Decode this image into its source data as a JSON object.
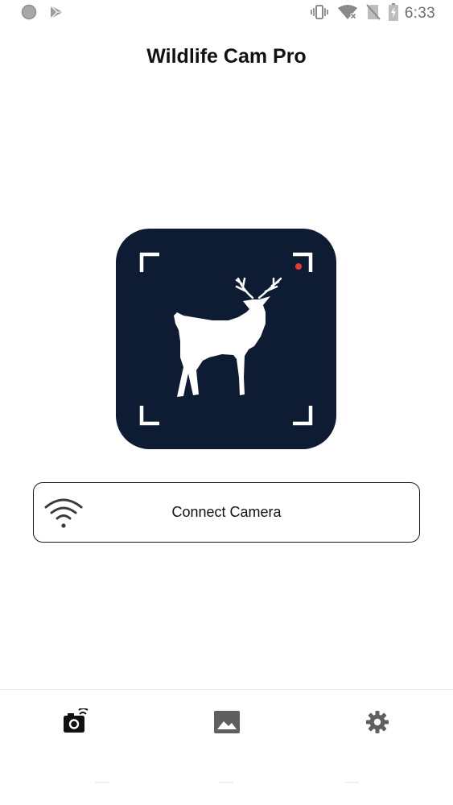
{
  "status_bar": {
    "time": "6:33",
    "icons": [
      "circle-notification-icon",
      "play-store-icon",
      "vibrate-icon",
      "wifi-off-icon",
      "no-sim-icon",
      "battery-charging-icon"
    ]
  },
  "app": {
    "title": "Wildlife Cam Pro"
  },
  "hero": {
    "icon": "deer-camera-logo",
    "background_color": "#0d1b33",
    "recording_dot_color": "#e53935"
  },
  "connect": {
    "label": "Connect Camera",
    "icon": "wifi-icon"
  },
  "bottom_nav": {
    "items": [
      {
        "name": "camera",
        "icon": "camera-wifi-icon",
        "active": true
      },
      {
        "name": "gallery",
        "icon": "image-icon",
        "active": false
      },
      {
        "name": "settings",
        "icon": "gear-icon",
        "active": false
      }
    ],
    "active_color": "#111111",
    "inactive_color": "#5f5f5f"
  }
}
